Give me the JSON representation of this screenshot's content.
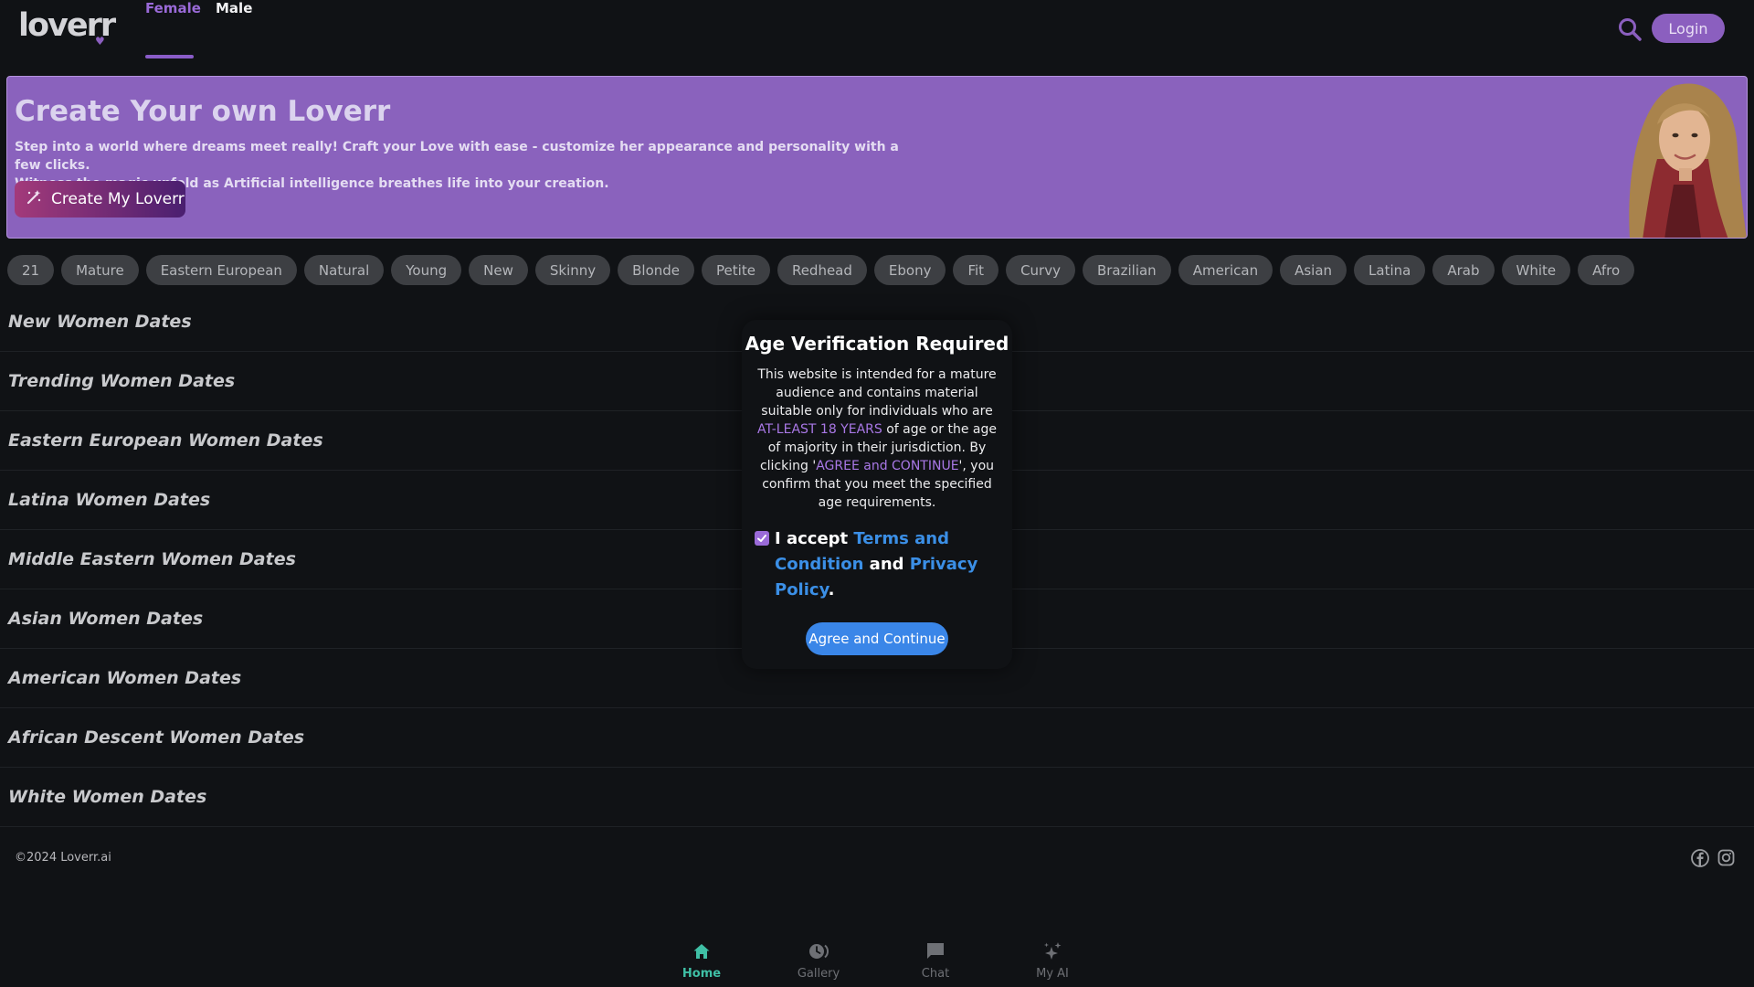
{
  "header": {
    "logo_text": "loverr",
    "tabs": [
      {
        "label": "Female",
        "active": true
      },
      {
        "label": "Male",
        "active": false
      }
    ],
    "login_label": "Login"
  },
  "banner": {
    "title": "Create Your own Loverr",
    "description_line1": "Step into a world where dreams meet really! Craft your Love with ease - customize her appearance and personality with a few clicks.",
    "description_line2": "Witness the magic unfold as Artificial intelligence breathes life into your creation.",
    "button_label": "Create My Loverr"
  },
  "chips": [
    "21",
    "Mature",
    "Eastern European",
    "Natural",
    "Young",
    "New",
    "Skinny",
    "Blonde",
    "Petite",
    "Redhead",
    "Ebony",
    "Fit",
    "Curvy",
    "Brazilian",
    "American",
    "Asian",
    "Latina",
    "Arab",
    "White",
    "Afro"
  ],
  "sections": [
    "New Women Dates",
    "Trending Women Dates",
    "Eastern European Women Dates",
    "Latina Women Dates",
    "Middle Eastern Women Dates",
    "Asian Women Dates",
    "American Women Dates",
    "African Descent Women Dates",
    "White Women Dates"
  ],
  "footer": {
    "copyright": "©2024 Loverr.ai"
  },
  "bottom_nav": {
    "items": [
      {
        "label": "Home",
        "icon": "home-icon",
        "active": true
      },
      {
        "label": "Gallery",
        "icon": "gallery-icon",
        "active": false
      },
      {
        "label": "Chat",
        "icon": "chat-icon",
        "active": false
      },
      {
        "label": "My AI",
        "icon": "sparkle-icon",
        "active": false
      }
    ]
  },
  "modal": {
    "title": "Age Verification Required",
    "body_1": "This website is intended for a mature audience and contains material suitable only for individuals who are ",
    "body_highlight_1": "AT-LEAST 18 YEARS",
    "body_2": " of age or the age of majority in their jurisdiction. By clicking '",
    "body_highlight_2": "AGREE and CONTINUE",
    "body_3": "', you confirm that you meet the specified age requirements.",
    "accept_prefix": "I accept ",
    "terms_link": "Terms and Condition",
    "accept_mid": " and ",
    "privacy_link": "Privacy Policy",
    "accept_suffix": ".",
    "checkbox_checked": true,
    "agree_button": "Agree and Continue"
  },
  "colors": {
    "accent": "#8b5fbf",
    "banner": "#8a62bd",
    "link": "#3b8fe6",
    "nav_active": "#3fbfa5",
    "agree_button": "#3a86e8"
  }
}
